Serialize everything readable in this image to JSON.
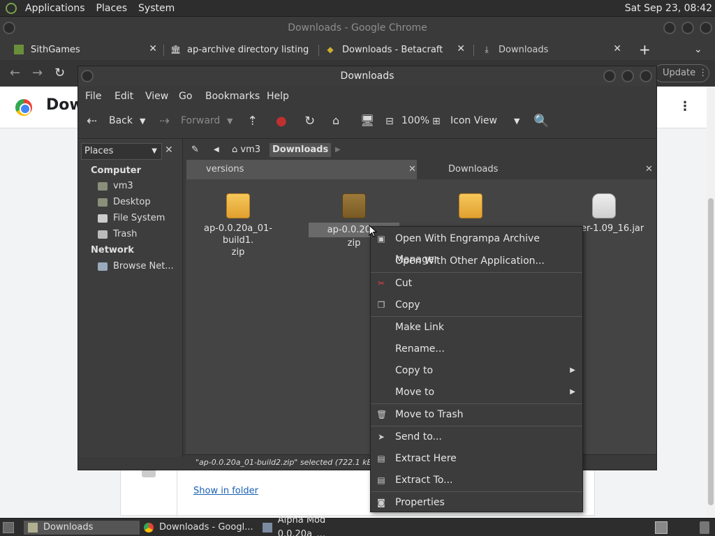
{
  "top_panel": {
    "menus": [
      "Applications",
      "Places",
      "System"
    ],
    "clock": "Sat Sep 23, 08:42"
  },
  "chrome": {
    "title": "Downloads - Google Chrome",
    "tabs": [
      {
        "label": "SithGames",
        "icon": "block-icon"
      },
      {
        "label": "ap-archive directory listing",
        "icon": "archive-icon"
      },
      {
        "label": "Downloads - Betacraft",
        "icon": "betacraft-icon"
      },
      {
        "label": "Downloads",
        "icon": "download-icon"
      }
    ],
    "update_label": "Update",
    "page_title": "Dow",
    "show_in_folder": "Show in folder"
  },
  "file_manager": {
    "title": "Downloads",
    "menus": [
      "File",
      "Edit",
      "View",
      "Go",
      "Bookmarks",
      "Help"
    ],
    "toolbar": {
      "back": "Back",
      "forward": "Forward",
      "zoom": "100%",
      "view_mode": "Icon View"
    },
    "sidebar": {
      "combo_label": "Places",
      "sections": [
        {
          "heading": "Computer",
          "items": [
            "vm3",
            "Desktop",
            "File System",
            "Trash"
          ]
        },
        {
          "heading": "Network",
          "items": [
            "Browse Net..."
          ]
        }
      ]
    },
    "path": [
      "vm3",
      "Downloads"
    ],
    "tabs": [
      "versions",
      "Downloads"
    ],
    "files": [
      {
        "line1": "ap-0.0.20a_01-build1.",
        "line2": "zip",
        "type": "pkg",
        "selected": false
      },
      {
        "line1": "ap-0.0.20a_",
        "line2": "zip",
        "type": "pkg",
        "selected": true
      },
      {
        "line1": "",
        "line2": "",
        "type": "pkg",
        "selected": false
      },
      {
        "line1": "er-1.09_16.jar",
        "line2": "",
        "type": "jar",
        "selected": false
      }
    ],
    "status": "\"ap-0.0.20a_01-build2.zip\" selected (722.1 kB), Fre"
  },
  "context_menu": {
    "items": [
      {
        "label": "Open With Engrampa Archive Manager",
        "icon": "archive-manager-icon"
      },
      {
        "label": "Open With Other Application...",
        "icon": ""
      },
      {
        "label": "Cut",
        "icon": "scissors-icon"
      },
      {
        "label": "Copy",
        "icon": "copy-icon"
      },
      {
        "label": "Make Link",
        "icon": ""
      },
      {
        "label": "Rename...",
        "icon": ""
      },
      {
        "label": "Copy to",
        "icon": "",
        "submenu": true
      },
      {
        "label": "Move to",
        "icon": "",
        "submenu": true
      },
      {
        "label": "Move to Trash",
        "icon": "trash-icon"
      },
      {
        "label": "Send to...",
        "icon": "send-icon"
      },
      {
        "label": "Extract Here",
        "icon": "extract-icon"
      },
      {
        "label": "Extract To...",
        "icon": "extract-to-icon"
      },
      {
        "label": "Properties",
        "icon": "properties-icon"
      }
    ]
  },
  "taskbar": {
    "items": [
      "Downloads",
      "Downloads - Googl...",
      "Alpha Mod 0.0.20a_..."
    ]
  }
}
